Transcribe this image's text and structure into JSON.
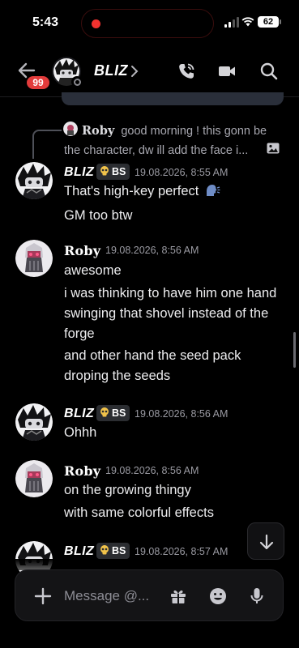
{
  "status_bar": {
    "time": "5:43",
    "battery": "62"
  },
  "header": {
    "title": "BLIZ",
    "unread_count": "99"
  },
  "reply": {
    "author": "Roby",
    "text": "good morning ! this gonn be the character, dw ill add the face i..."
  },
  "messages": [
    {
      "author": "BLIZ",
      "tag": "BS",
      "timestamp": "19.08.2026, 8:55 AM",
      "lines": [
        "That's high-key perfect",
        "GM too btw"
      ]
    },
    {
      "author": "Roby",
      "timestamp": "19.08.2026, 8:56 AM",
      "lines": [
        "awesome",
        "i was thinking to have him one hand swinging that shovel instead of the forge",
        "and other hand the seed pack droping the seeds"
      ]
    },
    {
      "author": "BLIZ",
      "tag": "BS",
      "timestamp": "19.08.2026, 8:56 AM",
      "lines": [
        "Ohhh"
      ]
    },
    {
      "author": "Roby",
      "timestamp": "19.08.2026, 8:56 AM",
      "lines": [
        "on the growing thingy",
        "with same colorful effects"
      ]
    },
    {
      "author": "BLIZ",
      "tag": "BS",
      "timestamp": "19.08.2026, 8:57 AM",
      "lines": []
    }
  ],
  "composer": {
    "placeholder": "Message @..."
  },
  "colors": {
    "unread_badge": "#e23b3b",
    "recording_dot": "#f2322f",
    "background": "#000000"
  },
  "icons": [
    "back-arrow-icon",
    "phone-icon",
    "video-camera-icon",
    "search-icon",
    "image-icon",
    "skull-icon",
    "speaking-head-icon",
    "arrow-down-icon",
    "plus-icon",
    "gift-icon",
    "emoji-icon",
    "microphone-icon"
  ]
}
